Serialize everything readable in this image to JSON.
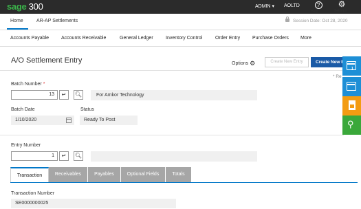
{
  "topbar": {
    "logo_brand": "sage",
    "logo_product": "300",
    "user": "ADMIN",
    "user_caret": "▾",
    "company": "AOLTD",
    "help_label": "Help",
    "settings_label": "Settings"
  },
  "header_tabs": {
    "home": "Home",
    "current": "AR-AP Settlements",
    "session_date": "Session Date: Oct 28, 2020"
  },
  "modules": [
    "Accounts Payable",
    "Accounts Receivable",
    "General Ledger",
    "Inventory Control",
    "Order Entry",
    "Purchase Orders",
    "More"
  ],
  "page": {
    "title": "A/O Settlement Entry",
    "options_label": "Options",
    "create_disabled_label": "Create New Entry",
    "create_primary_label": "Create New E",
    "required_note": "* Re"
  },
  "fields": {
    "batch_number_label": "Batch Number",
    "batch_required_marker": "*",
    "batch_number_value": "13",
    "batch_description": "For Amkor Technology",
    "batch_date_label": "Batch Date",
    "batch_date_value": "1/10/2020",
    "status_label": "Status",
    "status_value": "Ready To Post",
    "entry_number_label": "Entry Number",
    "entry_number_value": "1",
    "entry_description": "",
    "transaction_number_label": "Transaction Number",
    "transaction_number_value": "SE0000000025"
  },
  "detail_tabs": [
    "Transaction",
    "Receivables",
    "Payables",
    "Optional Fields",
    "Totals"
  ],
  "side_panel": {
    "badge": "1",
    "colors": {
      "blue": "#1e8fd6",
      "orange": "#f39c12",
      "green": "#3aa83a"
    }
  },
  "colors": {
    "topbar": "#2b2b2b",
    "brand_green": "#3bb44a",
    "primary_button": "#1a5aa6",
    "accent": "#0077c8"
  }
}
